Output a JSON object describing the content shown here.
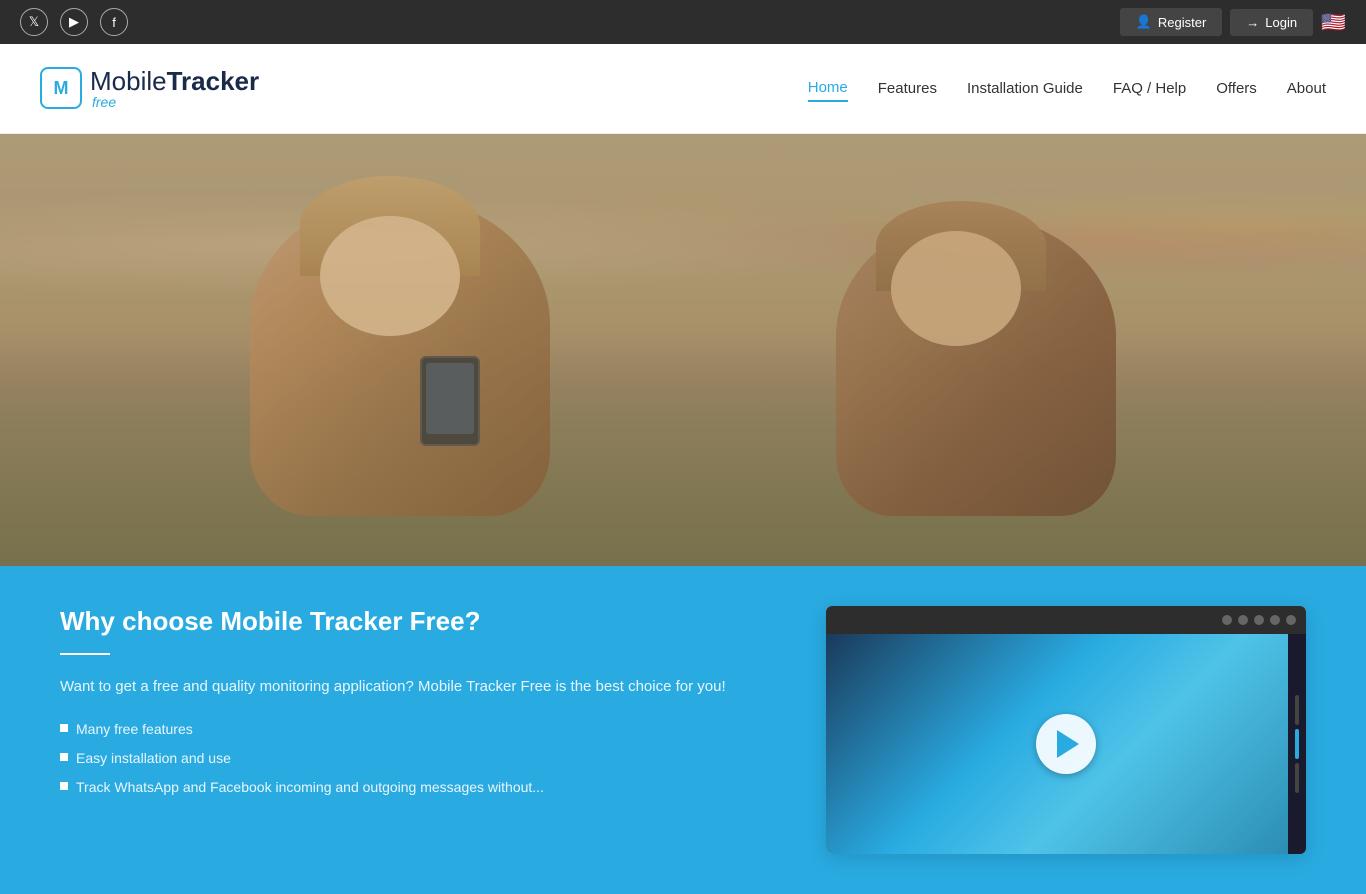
{
  "topbar": {
    "social": [
      {
        "name": "twitter",
        "icon": "𝕏"
      },
      {
        "name": "youtube",
        "icon": "▶"
      },
      {
        "name": "facebook",
        "icon": "f"
      }
    ],
    "register_label": "Register",
    "login_label": "Login",
    "flag_emoji": "🇺🇸"
  },
  "header": {
    "logo_letter": "M",
    "logo_text_plain": "Mobile",
    "logo_text_bold": "Tracker",
    "logo_sub": "free",
    "nav": [
      {
        "id": "home",
        "label": "Home",
        "active": true
      },
      {
        "id": "features",
        "label": "Features",
        "active": false
      },
      {
        "id": "installation",
        "label": "Installation Guide",
        "active": false
      },
      {
        "id": "faq",
        "label": "FAQ / Help",
        "active": false
      },
      {
        "id": "offers",
        "label": "Offers",
        "active": false
      },
      {
        "id": "about",
        "label": "About",
        "active": false
      }
    ]
  },
  "why": {
    "title": "Why choose Mobile Tracker Free?",
    "divider": true,
    "body": "Want to get a free and quality monitoring application? Mobile Tracker Free is the best choice for you!",
    "list": [
      "Many free features",
      "Easy installation and use",
      "Track WhatsApp and Facebook incoming and outgoing messages without..."
    ]
  },
  "video": {
    "play_label": "Play video"
  }
}
